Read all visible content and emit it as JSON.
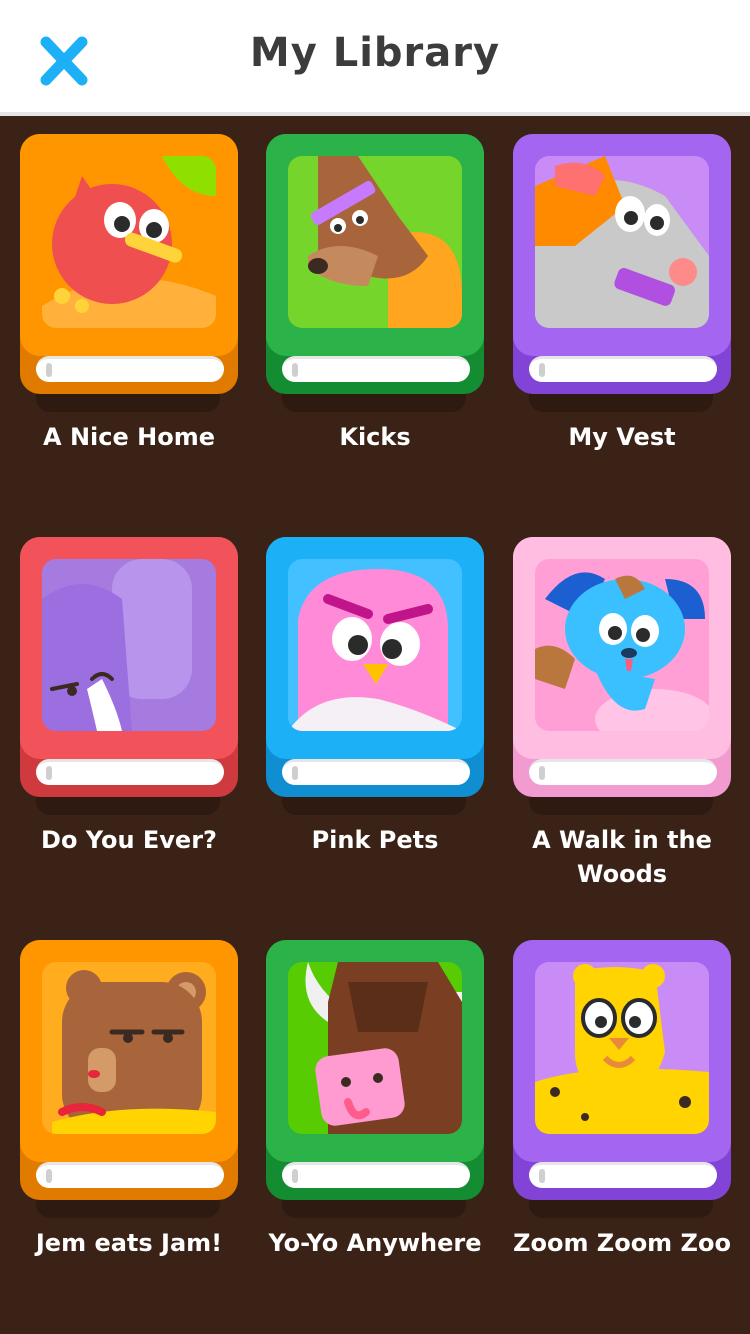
{
  "header": {
    "title": "My Library",
    "close_icon": "close-x-icon",
    "accent": "#1cb0f6"
  },
  "books": [
    {
      "title": "A Nice Home",
      "main": "#ff9600",
      "edge": "#e07b00",
      "bg": "#ff9600"
    },
    {
      "title": "Kicks",
      "main": "#2bb34a",
      "edge": "#138c32",
      "bg": "#75d52b"
    },
    {
      "title": "My Vest",
      "main": "#a466f0",
      "edge": "#8244d6",
      "bg": "#c98cf7"
    },
    {
      "title": "Do You Ever?",
      "main": "#f2535a",
      "edge": "#cf3a3f",
      "bg": "#a57be0"
    },
    {
      "title": "Pink Pets",
      "main": "#1cb0f6",
      "edge": "#0f8fd2",
      "bg": "#42c0ff"
    },
    {
      "title": "A Walk in the Woods",
      "main": "#ffbde2",
      "edge": "#f29bd0",
      "bg": "#ff9fd6"
    },
    {
      "title": "Jem eats Jam!",
      "main": "#ff9600",
      "edge": "#e07b00",
      "bg": "#ffad1f"
    },
    {
      "title": "Yo-Yo Anywhere",
      "main": "#2bb34a",
      "edge": "#138c32",
      "bg": "#58cc02"
    },
    {
      "title": "Zoom Zoom Zoo",
      "main": "#a466f0",
      "edge": "#8244d6",
      "bg": "#c98cf7"
    }
  ]
}
